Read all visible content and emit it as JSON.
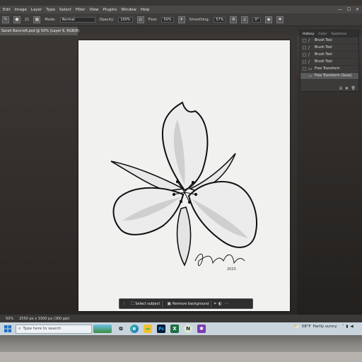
{
  "menubar": {
    "items": [
      "Edit",
      "Image",
      "Layer",
      "Type",
      "Select",
      "Filter",
      "View",
      "Plugins",
      "Window",
      "Help"
    ]
  },
  "options": {
    "mode_label": "Mode:",
    "mode_value": "Normal",
    "opacity_label": "Opacity:",
    "opacity_value": "100%",
    "flow_label": "Flow:",
    "flow_value": "50%",
    "smoothing_label": "Smoothing:",
    "smoothing_value": "57%",
    "angle_value": "0°",
    "brush_size": "21"
  },
  "document": {
    "tab_title": "Sarah Bancroft.psd @ 50% (Layer 6, RGB/8)",
    "signature_date": "2023"
  },
  "context_bar": {
    "select_subject": "Select subject",
    "remove_background": "Remove background"
  },
  "history_panel": {
    "tabs": [
      "History",
      "Color",
      "Swatches"
    ],
    "steps": [
      {
        "label": "Brush Tool",
        "icon": "brush-icon"
      },
      {
        "label": "Brush Tool",
        "icon": "brush-icon"
      },
      {
        "label": "Brush Tool",
        "icon": "brush-icon"
      },
      {
        "label": "Brush Tool",
        "icon": "brush-icon"
      },
      {
        "label": "Free Transform",
        "icon": "transform-icon"
      },
      {
        "label": "Free Transform (Save)",
        "icon": "transform-icon"
      }
    ]
  },
  "status": {
    "zoom": "50%",
    "doc_size": "2550 px x 3300 px (300 ppi)"
  },
  "taskbar": {
    "search_placeholder": "Type here to search",
    "weather_temp": "58°F",
    "weather_text": "Partly sunny"
  },
  "colors": {
    "menubar": "#4a4847",
    "optbar": "#3f3d3c",
    "paper": "#f1f1f0",
    "history_active": "#575757",
    "taskbar": "#c9d4dc"
  }
}
